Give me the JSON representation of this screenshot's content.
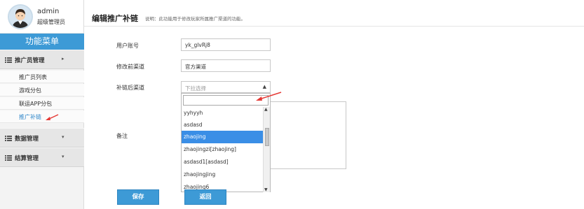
{
  "user": {
    "name": "admin",
    "role": "超级管理员"
  },
  "menu": {
    "title": "功能菜单",
    "groups": [
      {
        "label": "推广员管理",
        "arrow": "▸"
      },
      {
        "label": "数据管理",
        "arrow": "▾"
      },
      {
        "label": "结算管理",
        "arrow": "▾"
      }
    ],
    "subitems": [
      {
        "label": "推广员列表"
      },
      {
        "label": "游戏分包"
      },
      {
        "label": "联运APP分包"
      },
      {
        "label": "推广补链"
      }
    ]
  },
  "page": {
    "title": "编辑推广补链",
    "description": "说明：此功能用于修改玩家所属推广渠道的功能。"
  },
  "form": {
    "account_label": "用户账号",
    "account_value": "yk_glvRj8",
    "before_label": "修改前渠道",
    "before_value": "官方渠道",
    "after_label": "补链后渠道",
    "after_placeholder": "下拉选择",
    "remark_label": "备注",
    "save_label": "保存",
    "back_label": "返回"
  },
  "dropdown": {
    "search_value": "",
    "options": [
      "yyhyyh",
      "asdasd",
      "zhaojing",
      "zhaojingzi[zhaojing]",
      "asdasd1[asdasd]",
      "zhaojingjing",
      "zhaojing6"
    ],
    "selected": "zhaojing"
  },
  "colors": {
    "accent": "#3d9ad6",
    "highlight": "#3a8ee6",
    "annotation": "#e53935"
  }
}
